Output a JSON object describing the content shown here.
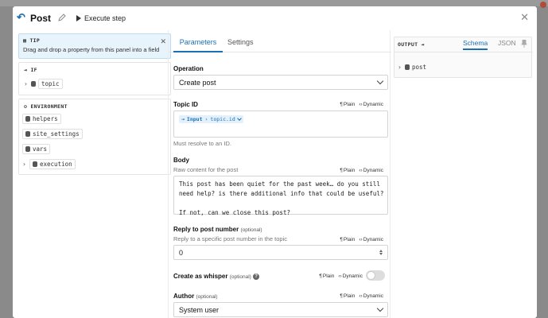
{
  "header": {
    "title": "Post",
    "execute_label": "Execute step"
  },
  "tip": {
    "heading": "TIP",
    "text": "Drag and drop a property from this panel into a field"
  },
  "if_section": {
    "heading": "IF",
    "items": [
      {
        "label": "topic"
      }
    ]
  },
  "env_section": {
    "heading": "ENVIRONMENT",
    "items": [
      {
        "label": "helpers"
      },
      {
        "label": "site_settings"
      },
      {
        "label": "vars"
      },
      {
        "label": "execution"
      }
    ]
  },
  "tabs": {
    "parameters": "Parameters",
    "settings": "Settings"
  },
  "mode": {
    "plain": "Plain",
    "dynamic": "Dynamic"
  },
  "operation": {
    "label": "Operation",
    "value": "Create post"
  },
  "topic_id": {
    "label": "Topic ID",
    "pill_source": "Input",
    "pill_path": "topic.id",
    "help": "Must resolve to an ID."
  },
  "body": {
    "label": "Body",
    "help": "Raw content for the post",
    "value": "This post has been quiet for the past week… do you still need help? is there additional info that could be useful?\n\nIf not, can we close this post?"
  },
  "reply_to": {
    "label": "Reply to post number",
    "optional": "(optional)",
    "help": "Reply to a specific post number in the topic",
    "value": "0"
  },
  "whisper": {
    "label": "Create as whisper",
    "optional": "(optional)",
    "enabled": false
  },
  "author": {
    "label": "Author",
    "optional": "(optional)",
    "value": "System user"
  },
  "output": {
    "heading": "OUTPUT",
    "tab_schema": "Schema",
    "tab_json": "JSON",
    "root": "post"
  },
  "colors": {
    "accent": "#1a6fb5",
    "tip_bg": "#e8f4fc"
  }
}
